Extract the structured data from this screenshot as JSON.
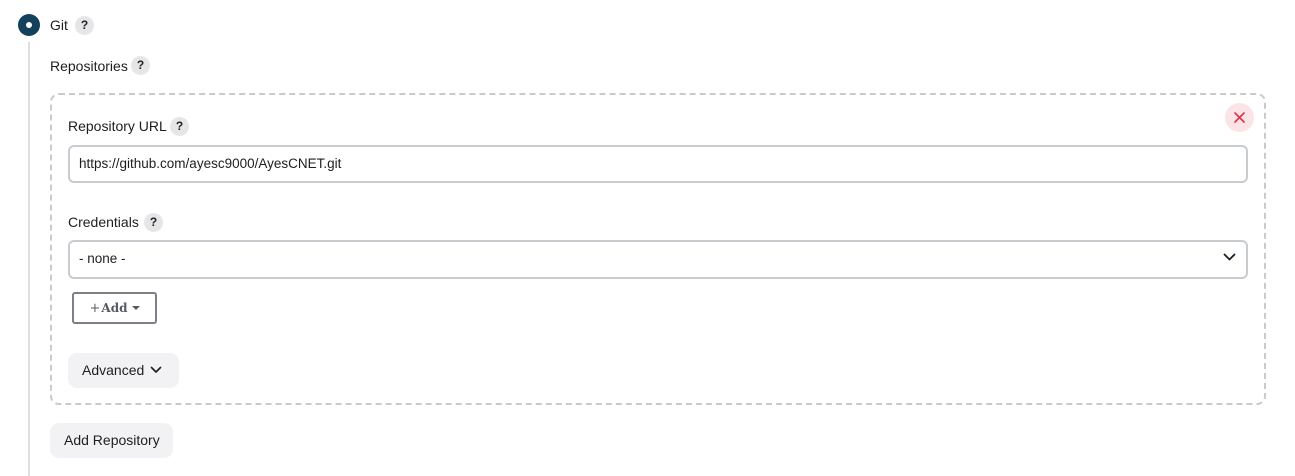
{
  "scm": {
    "option_label": "Git",
    "help_glyph": "?"
  },
  "repositories": {
    "label": "Repositories",
    "repository_url_label": "Repository URL",
    "repository_url_value": "https://github.com/ayesc9000/AyesCNET.git",
    "credentials_label": "Credentials",
    "credentials_selected": "- none -",
    "add_label": "Add",
    "add_prefix": "+",
    "advanced_label": "Advanced",
    "add_repository_label": "Add Repository"
  },
  "icons": {
    "radio": "radio-selected-icon",
    "remove": "close-icon",
    "select_arrow": "chevron-down-icon",
    "advanced_arrow": "chevron-down-icon",
    "add_caret": "caret-down-icon"
  },
  "colors": {
    "radio_fill": "#13405c",
    "remove_bg": "#fbe4e6",
    "remove_x": "#e0304d",
    "help_bg": "#e6e6e8",
    "soft_button_bg": "#f2f2f4",
    "input_border": "#c8ccd0",
    "card_border": "#cacaca"
  }
}
